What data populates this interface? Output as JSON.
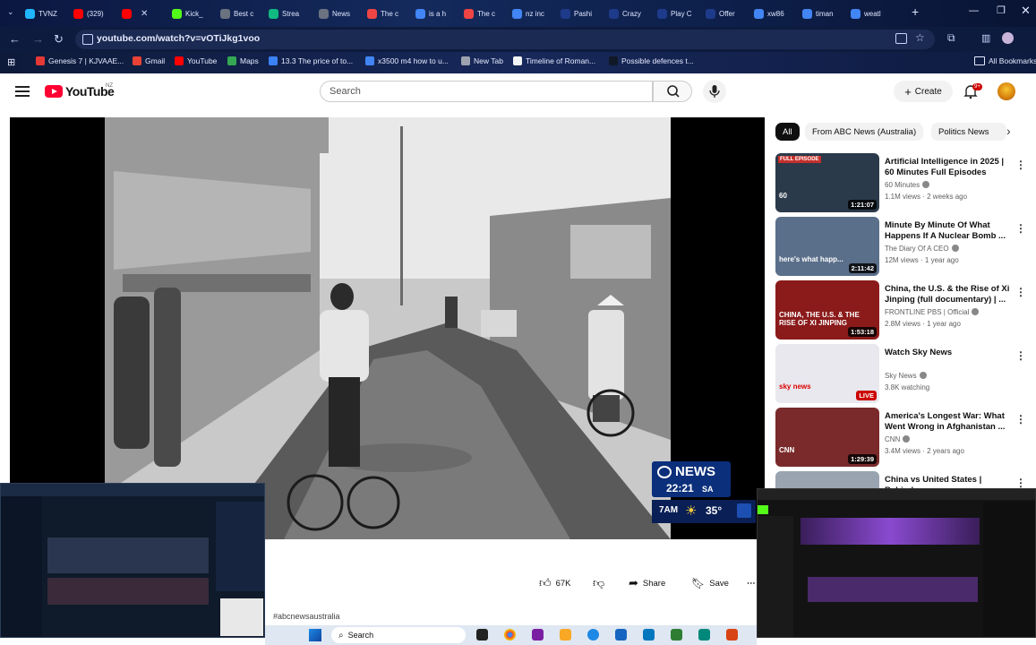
{
  "browser": {
    "tabs": [
      {
        "label": "TVNZ",
        "color": "#1fb6ff"
      },
      {
        "label": "(329)",
        "color": "#ff0000"
      },
      {
        "label": "",
        "color": "#ff0000"
      },
      {
        "label": "Kick_",
        "color": "#53fc18"
      },
      {
        "label": "Best c",
        "color": "#6b7280"
      },
      {
        "label": "Strea",
        "color": "#10b981"
      },
      {
        "label": "News",
        "color": "#6b7280"
      },
      {
        "label": "The c",
        "color": "#ef4444"
      },
      {
        "label": "is a h",
        "color": "#4285f4"
      },
      {
        "label": "The c",
        "color": "#ef4444"
      },
      {
        "label": "nz inc",
        "color": "#4285f4"
      },
      {
        "label": "Pashi",
        "color": "#1e3a8a"
      },
      {
        "label": "Crazy",
        "color": "#1e3a8a"
      },
      {
        "label": "Play C",
        "color": "#1e3a8a"
      },
      {
        "label": "Offer",
        "color": "#1e3a8a"
      },
      {
        "label": "xw86",
        "color": "#4285f4"
      },
      {
        "label": "timan",
        "color": "#4285f4"
      },
      {
        "label": "weatl",
        "color": "#4285f4"
      }
    ],
    "url": "youtube.com/watch?v=vOTiJkg1voo",
    "bookmarks": [
      {
        "label": "Genesis 7 | KJVAAE...",
        "color": "#e53935"
      },
      {
        "label": "Gmail",
        "color": "#ea4335"
      },
      {
        "label": "YouTube",
        "color": "#ff0000"
      },
      {
        "label": "Maps",
        "color": "#34a853"
      },
      {
        "label": "13.3 The price of to...",
        "color": "#3b82f6"
      },
      {
        "label": "x3500 m4 how to u...",
        "color": "#4285f4"
      },
      {
        "label": "New Tab",
        "color": "#9ca3af"
      },
      {
        "label": "Timeline of Roman...",
        "color": "#f3f4f6"
      },
      {
        "label": "Possible defences t...",
        "color": "#111827"
      }
    ],
    "all_bookmarks_label": "All Bookmarks"
  },
  "youtube": {
    "logo_text": "YouTube",
    "region": "NZ",
    "search_placeholder": "Search",
    "create_label": "Create",
    "notification_count": "9+",
    "chips": [
      {
        "label": "All",
        "selected": true
      },
      {
        "label": "From ABC News (Australia)",
        "selected": false
      },
      {
        "label": "Politics News",
        "selected": false
      }
    ],
    "recommendations": [
      {
        "title": "Artificial Intelligence in 2025 | 60 Minutes Full Episodes",
        "channel": "60 Minutes",
        "meta": "1.1M views · 2 weeks ago",
        "duration": "1:21:07",
        "badge": "FULL EPISODE",
        "thumb_text": "60",
        "thumb_color": "#2b3a4a"
      },
      {
        "title": "Minute By Minute Of What Happens If A Nuclear Bomb ...",
        "channel": "The Diary Of A CEO",
        "meta": "12M views · 1 year ago",
        "duration": "2:11:42",
        "badge": "",
        "thumb_text": "here's what happ...",
        "thumb_color": "#5a6f8a"
      },
      {
        "title": "China, the U.S. & the Rise of Xi Jinping (full documentary) | ...",
        "channel": "FRONTLINE PBS | Official",
        "meta": "2.8M views · 1 year ago",
        "duration": "1:53:18",
        "badge": "",
        "thumb_text": "CHINA, THE U.S. & THE RISE OF XI JINPING",
        "thumb_color": "#8b1a1a"
      },
      {
        "title": "Watch Sky News",
        "channel": "Sky News",
        "meta": "3.8K watching",
        "duration": "LIVE",
        "badge": "",
        "thumb_text": "sky news",
        "thumb_color": "#e8e8ee"
      },
      {
        "title": "America's Longest War: What Went Wrong in Afghanistan ...",
        "channel": "CNN",
        "meta": "3.4M views · 2 years ago",
        "duration": "1:29:39",
        "badge": "",
        "thumb_text": "CNN",
        "thumb_color": "#7a2a2a"
      },
      {
        "title": "China vs United States | Behind",
        "channel": "",
        "meta": "",
        "duration": "",
        "badge": "",
        "thumb_text": "",
        "thumb_color": "#9aa3b0"
      }
    ],
    "actions": {
      "like_count": "67K",
      "share_label": "Share",
      "save_label": "Save"
    },
    "hashtag": "#abcnewsaustralia",
    "overlay_badge": {
      "brand": "NEWS",
      "time": "22:21",
      "zone": "SA",
      "temp_label": "7AM",
      "temp": "35°"
    }
  },
  "taskbar": {
    "search_label": "Search"
  }
}
